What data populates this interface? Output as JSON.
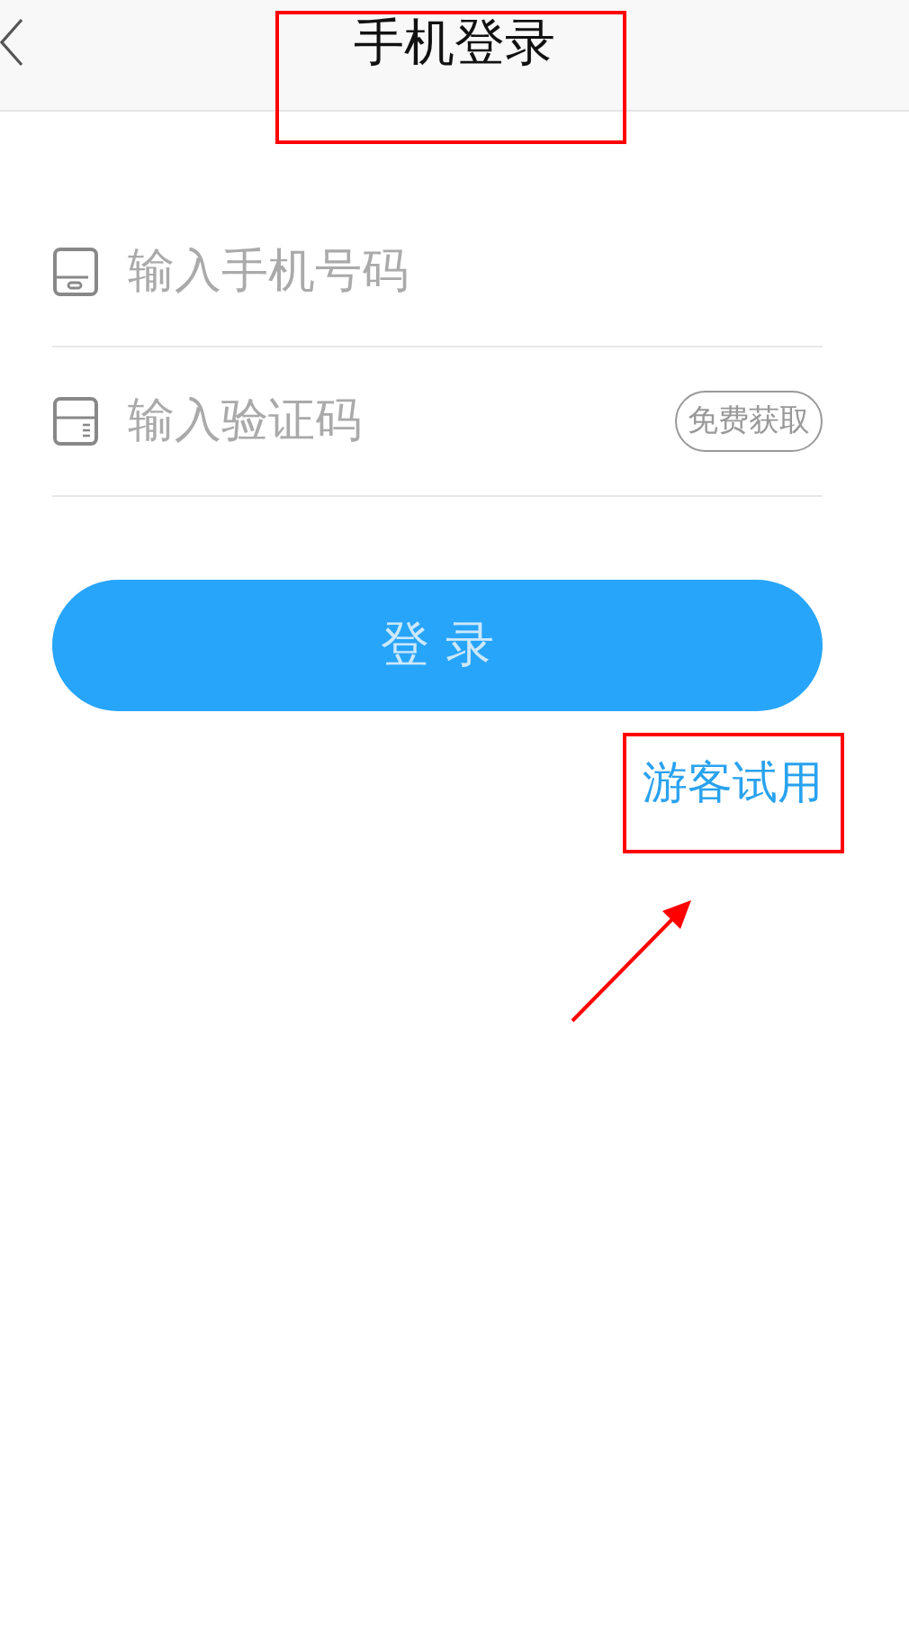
{
  "header": {
    "title": "手机登录"
  },
  "fields": [
    {
      "kind": "phone",
      "placeholder": "输入手机号码"
    },
    {
      "kind": "code",
      "placeholder": "输入验证码",
      "action": "免费获取"
    }
  ],
  "login_button": "登 录",
  "guest_link": "游客试用"
}
